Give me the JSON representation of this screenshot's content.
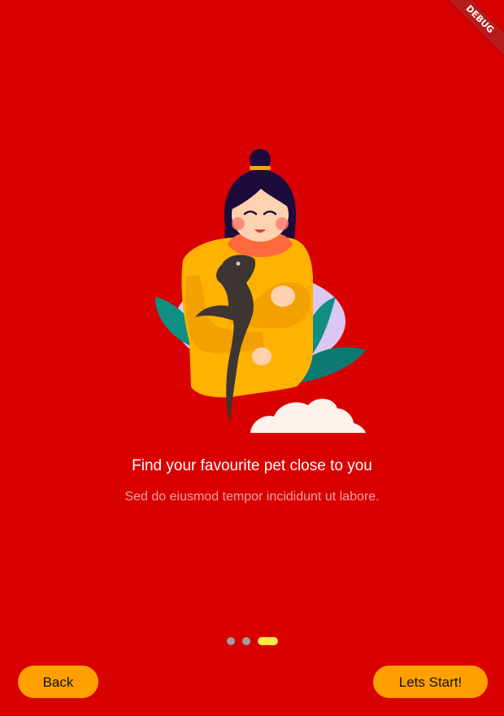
{
  "debug_banner": {
    "label": "DEBUG"
  },
  "onboarding": {
    "title": "Find your favourite pet close to you",
    "subtitle": "Sed do eiusmod tempor incididunt ut labore.",
    "page_indicator": {
      "total": 3,
      "active_index": 2
    }
  },
  "buttons": {
    "back_label": "Back",
    "start_label": "Lets Start!"
  },
  "colors": {
    "background": "#d90000",
    "button": "#ffa000",
    "indicator_active": "#ffeb3b",
    "indicator_inactive": "#9e9e9e",
    "subtitle_text": "#f0a0a0"
  },
  "illustration": {
    "icon": "girl-holding-lizard-illustration"
  }
}
